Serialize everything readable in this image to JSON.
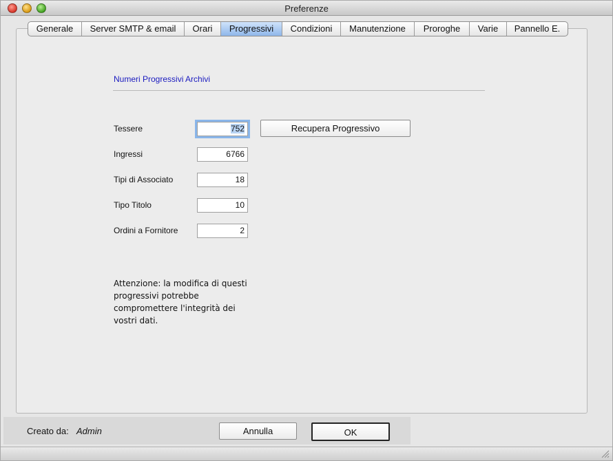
{
  "window": {
    "title": "Preferenze"
  },
  "tabs": [
    {
      "label": "Generale",
      "active": false
    },
    {
      "label": "Server SMTP & email",
      "active": false
    },
    {
      "label": "Orari",
      "active": false
    },
    {
      "label": "Progressivi",
      "active": true
    },
    {
      "label": "Condizioni",
      "active": false
    },
    {
      "label": "Manutenzione",
      "active": false
    },
    {
      "label": "Proroghe",
      "active": false
    },
    {
      "label": "Varie",
      "active": false
    },
    {
      "label": "Pannello E.",
      "active": false
    }
  ],
  "section": {
    "title": "Numeri Progressivi Archivi"
  },
  "fields": [
    {
      "label": "Tessere",
      "value": "752"
    },
    {
      "label": "Ingressi",
      "value": "6766"
    },
    {
      "label": "Tipi di Associato",
      "value": "18"
    },
    {
      "label": "Tipo Titolo",
      "value": "10"
    },
    {
      "label": "Ordini a Fornitore",
      "value": "2"
    }
  ],
  "buttons": {
    "recupera": "Recupera Progressivo",
    "annulla": "Annulla",
    "ok": "OK"
  },
  "warning": "Attenzione: la modifica di questi progressivi potrebbe compromettere l'integrità dei vostri dati.",
  "footer": {
    "creato_label": "Creato da:",
    "creato_value": "Admin"
  },
  "colors": {
    "accent": "#1a1abf",
    "active_tab": "#8fb7ea",
    "focus": "#8ab6ea"
  },
  "icons": [
    "close-icon",
    "minimize-icon",
    "zoom-icon",
    "resize-grip-icon"
  ]
}
